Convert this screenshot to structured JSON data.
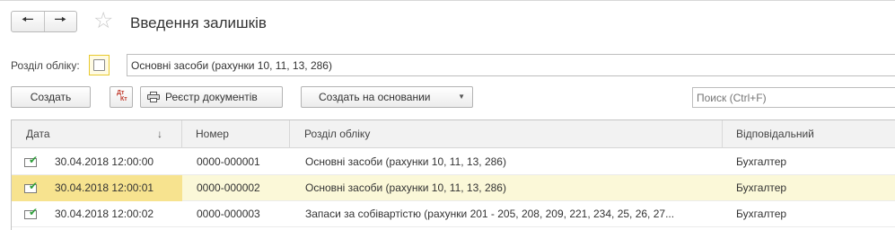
{
  "header": {
    "title": "Введення залишків",
    "back_icon": "arrow-left-icon",
    "forward_icon": "arrow-right-icon",
    "favorite_icon": "star-icon"
  },
  "filter": {
    "label": "Розділ обліку:",
    "checked": false,
    "value": "Основні засоби (рахунки 10, 11, 13, 286)"
  },
  "toolbar": {
    "create_label": "Создать",
    "dtkt_icon": "dt-kt-icon",
    "dtkt_a": "Дт",
    "dtkt_b": "Кт",
    "registry_label": "Реєстр документів",
    "basis_label": "Создать на основании",
    "search_placeholder": "Поиск (Ctrl+F)"
  },
  "table": {
    "columns": [
      "Дата",
      "Номер",
      "Розділ обліку",
      "Відповідальний"
    ],
    "sort_indicator": "↓",
    "rows": [
      {
        "date": "30.04.2018 12:00:00",
        "number": "0000-000001",
        "section": "Основні засоби (рахунки 10, 11, 13, 286)",
        "responsible": "Бухгалтер"
      },
      {
        "date": "30.04.2018 12:00:01",
        "number": "0000-000002",
        "section": "Основні засоби (рахунки 10, 11, 13, 286)",
        "responsible": "Бухгалтер"
      },
      {
        "date": "30.04.2018 12:00:02",
        "number": "0000-000003",
        "section": "Запаси за собівартістю (рахунки 201 - 205, 208, 209, 221, 234, 25, 26, 27...",
        "responsible": "Бухгалтер"
      }
    ],
    "selected_row": 1
  },
  "colors": {
    "selected_row_bg": "#fbf8d8",
    "selected_cell_bg": "#f7e38f",
    "posted_check": "#2e9e3a",
    "dtkt_red": "#c0392b"
  }
}
